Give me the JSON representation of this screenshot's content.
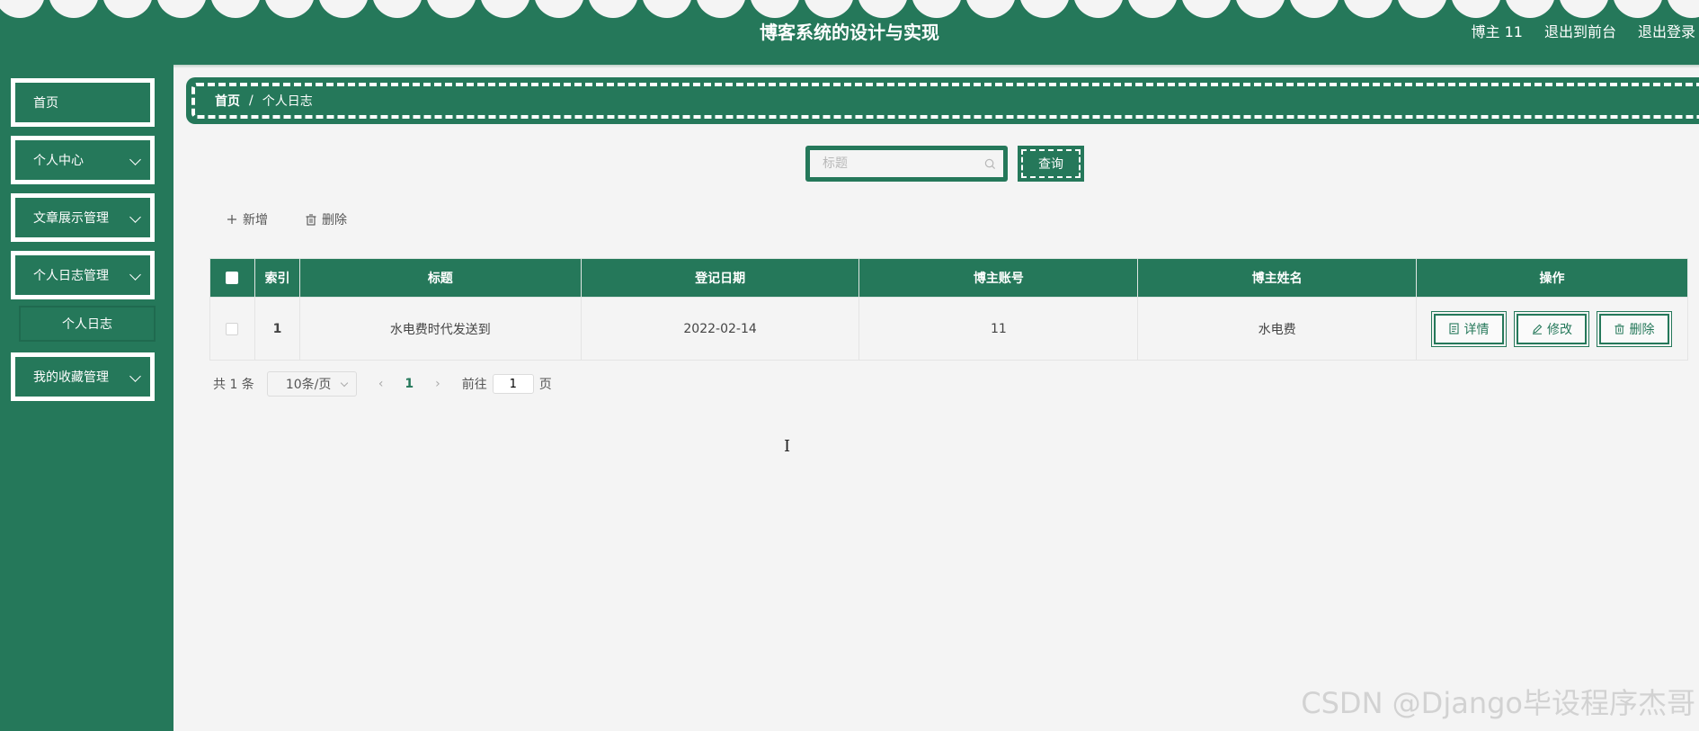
{
  "header": {
    "title": "博客系统的设计与实现",
    "user_label": "博主 11",
    "to_frontend": "退出到前台",
    "logout": "退出登录"
  },
  "sidebar": {
    "items": [
      {
        "label": "首页",
        "has_children": false
      },
      {
        "label": "个人中心",
        "has_children": true
      },
      {
        "label": "文章展示管理",
        "has_children": true
      },
      {
        "label": "个人日志管理",
        "has_children": true
      },
      {
        "label": "我的收藏管理",
        "has_children": true
      }
    ],
    "subitem": {
      "label": "个人日志"
    }
  },
  "breadcrumb": {
    "home": "首页",
    "separator": "/",
    "current": "个人日志"
  },
  "search": {
    "placeholder": "标题",
    "value": "",
    "button_label": "查询"
  },
  "toolbar": {
    "add_label": "新增",
    "delete_label": "删除"
  },
  "table": {
    "columns": [
      "索引",
      "标题",
      "登记日期",
      "博主账号",
      "博主姓名",
      "操作"
    ],
    "rows": [
      {
        "index": "1",
        "title": "水电费时代发送到",
        "date": "2022-02-14",
        "account": "11",
        "name": "水电费"
      }
    ],
    "row_actions": {
      "detail": "详情",
      "edit": "修改",
      "delete": "删除"
    }
  },
  "pagination": {
    "total_text": "共 1 条",
    "page_size": "10条/页",
    "current_page": "1",
    "goto_prefix": "前往",
    "goto_value": "1",
    "goto_suffix": "页"
  },
  "watermark": "CSDN @Django毕设程序杰哥",
  "colors": {
    "primary": "#25785a",
    "background": "#f4f4f4"
  }
}
